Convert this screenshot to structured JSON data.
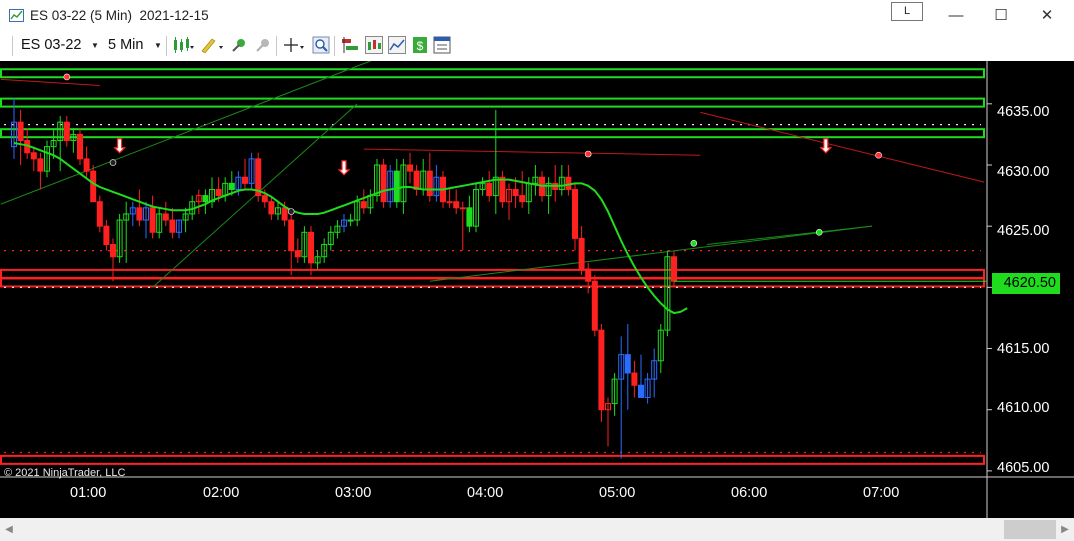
{
  "window": {
    "title": "ES 03-22 (5 Min)  2021-12-15",
    "layout_button": "L",
    "minimize": "—",
    "maximize": "☐",
    "close": "✕"
  },
  "toolbar": {
    "instrument": "ES 03-22",
    "period": "5 Min",
    "icons": [
      "bar-type-icon",
      "drawing-tool-icon",
      "attach-icon",
      "detach-icon",
      "crosshair-icon",
      "zoom-icon",
      "strategy-icon",
      "indicators-icon",
      "chart-trader-icon",
      "money-icon",
      "properties-icon"
    ]
  },
  "chart": {
    "copyright": "© 2021 NinjaTrader, LLC",
    "last_price_label": "4620.50",
    "colors": {
      "background": "#000000",
      "up_candle": "#1fdc1f",
      "down_candle": "#ff2020",
      "blue_candle": "#2a6cff",
      "ma_line": "#1fdc1f",
      "support_zone": "#ff2020",
      "resistance_zone": "#1fdc1f"
    }
  },
  "chart_data": {
    "type": "candlestick",
    "title": "ES 03-22 (5 Min)  2021-12-15",
    "instrument": "ES 03-22",
    "interval": "5 Min",
    "ylim": [
      4604.5,
      4638.5
    ],
    "y_ticks": [
      "4635.00",
      "4630.00",
      "4625.00",
      "4620.00",
      "4615.00",
      "4610.00",
      "4605.00"
    ],
    "x_ticks": [
      "01:00",
      "02:00",
      "03:00",
      "04:00",
      "05:00",
      "06:00",
      "07:00"
    ],
    "last_price": 4620.5,
    "candles": [
      {
        "o": 4631.5,
        "h": 4635.5,
        "l": 4630.5,
        "c": 4633.5,
        "col": "blue"
      },
      {
        "o": 4633.5,
        "h": 4634.5,
        "l": 4630.0,
        "c": 4632.0,
        "col": "red"
      },
      {
        "o": 4632.0,
        "h": 4633.0,
        "l": 4630.5,
        "c": 4631.0,
        "col": "red"
      },
      {
        "o": 4631.0,
        "h": 4631.5,
        "l": 4629.5,
        "c": 4630.5,
        "col": "red"
      },
      {
        "o": 4630.5,
        "h": 4631.0,
        "l": 4628.0,
        "c": 4629.5,
        "col": "red"
      },
      {
        "o": 4629.5,
        "h": 4632.0,
        "l": 4629.0,
        "c": 4631.5,
        "col": "green"
      },
      {
        "o": 4631.5,
        "h": 4633.0,
        "l": 4630.5,
        "c": 4632.0,
        "col": "green"
      },
      {
        "o": 4632.0,
        "h": 4634.0,
        "l": 4629.5,
        "c": 4633.5,
        "col": "green"
      },
      {
        "o": 4633.5,
        "h": 4634.0,
        "l": 4631.5,
        "c": 4632.0,
        "col": "red"
      },
      {
        "o": 4632.0,
        "h": 4633.0,
        "l": 4631.0,
        "c": 4632.5,
        "col": "green"
      },
      {
        "o": 4632.5,
        "h": 4633.0,
        "l": 4630.0,
        "c": 4630.5,
        "col": "red"
      },
      {
        "o": 4630.5,
        "h": 4631.5,
        "l": 4629.0,
        "c": 4629.5,
        "col": "red"
      },
      {
        "o": 4629.5,
        "h": 4630.0,
        "l": 4627.0,
        "c": 4627.0,
        "col": "red"
      },
      {
        "o": 4627.0,
        "h": 4627.5,
        "l": 4624.5,
        "c": 4625.0,
        "col": "red"
      },
      {
        "o": 4625.0,
        "h": 4625.5,
        "l": 4623.0,
        "c": 4623.5,
        "col": "red"
      },
      {
        "o": 4623.5,
        "h": 4624.0,
        "l": 4620.5,
        "c": 4622.5,
        "col": "red"
      },
      {
        "o": 4622.5,
        "h": 4626.0,
        "l": 4622.0,
        "c": 4625.5,
        "col": "green"
      },
      {
        "o": 4625.5,
        "h": 4627.0,
        "l": 4622.0,
        "c": 4626.0,
        "col": "green"
      },
      {
        "o": 4626.0,
        "h": 4627.0,
        "l": 4625.0,
        "c": 4626.5,
        "col": "blue"
      },
      {
        "o": 4626.5,
        "h": 4628.0,
        "l": 4625.0,
        "c": 4625.5,
        "col": "red"
      },
      {
        "o": 4625.5,
        "h": 4627.0,
        "l": 4624.0,
        "c": 4626.5,
        "col": "blue"
      },
      {
        "o": 4626.5,
        "h": 4627.5,
        "l": 4624.0,
        "c": 4624.5,
        "col": "red"
      },
      {
        "o": 4624.5,
        "h": 4626.5,
        "l": 4624.0,
        "c": 4626.0,
        "col": "green"
      },
      {
        "o": 4626.0,
        "h": 4627.0,
        "l": 4625.0,
        "c": 4625.5,
        "col": "red"
      },
      {
        "o": 4625.5,
        "h": 4626.5,
        "l": 4624.0,
        "c": 4624.5,
        "col": "red"
      },
      {
        "o": 4624.5,
        "h": 4625.5,
        "l": 4624.0,
        "c": 4625.5,
        "col": "blue"
      },
      {
        "o": 4625.5,
        "h": 4626.5,
        "l": 4624.5,
        "c": 4626.0,
        "col": "green"
      },
      {
        "o": 4626.0,
        "h": 4627.5,
        "l": 4625.5,
        "c": 4627.0,
        "col": "green"
      },
      {
        "o": 4627.0,
        "h": 4628.0,
        "l": 4626.0,
        "c": 4627.5,
        "col": "red"
      },
      {
        "o": 4627.5,
        "h": 4628.0,
        "l": 4626.0,
        "c": 4627.0,
        "col": "green"
      },
      {
        "o": 4627.0,
        "h": 4629.0,
        "l": 4626.5,
        "c": 4628.0,
        "col": "green"
      },
      {
        "o": 4628.0,
        "h": 4629.0,
        "l": 4627.0,
        "c": 4627.5,
        "col": "red"
      },
      {
        "o": 4627.5,
        "h": 4629.0,
        "l": 4627.0,
        "c": 4628.5,
        "col": "green"
      },
      {
        "o": 4628.5,
        "h": 4629.5,
        "l": 4627.5,
        "c": 4628.0,
        "col": "green"
      },
      {
        "o": 4628.0,
        "h": 4629.5,
        "l": 4627.5,
        "c": 4629.0,
        "col": "blue"
      },
      {
        "o": 4629.0,
        "h": 4630.5,
        "l": 4628.0,
        "c": 4628.5,
        "col": "red"
      },
      {
        "o": 4628.5,
        "h": 4631.0,
        "l": 4628.0,
        "c": 4630.5,
        "col": "blue"
      },
      {
        "o": 4630.5,
        "h": 4631.0,
        "l": 4627.0,
        "c": 4627.5,
        "col": "red"
      },
      {
        "o": 4627.5,
        "h": 4628.0,
        "l": 4626.5,
        "c": 4627.0,
        "col": "red"
      },
      {
        "o": 4627.0,
        "h": 4627.5,
        "l": 4625.5,
        "c": 4626.0,
        "col": "red"
      },
      {
        "o": 4626.0,
        "h": 4627.0,
        "l": 4625.5,
        "c": 4626.5,
        "col": "green"
      },
      {
        "o": 4626.5,
        "h": 4627.0,
        "l": 4625.0,
        "c": 4625.5,
        "col": "red"
      },
      {
        "o": 4625.5,
        "h": 4626.0,
        "l": 4621.0,
        "c": 4623.0,
        "col": "red"
      },
      {
        "o": 4623.0,
        "h": 4624.0,
        "l": 4622.0,
        "c": 4622.5,
        "col": "red"
      },
      {
        "o": 4622.5,
        "h": 4625.0,
        "l": 4622.0,
        "c": 4624.5,
        "col": "green"
      },
      {
        "o": 4624.5,
        "h": 4625.0,
        "l": 4621.0,
        "c": 4622.0,
        "col": "red"
      },
      {
        "o": 4622.0,
        "h": 4623.0,
        "l": 4621.5,
        "c": 4622.5,
        "col": "green"
      },
      {
        "o": 4622.5,
        "h": 4624.0,
        "l": 4622.0,
        "c": 4623.5,
        "col": "green"
      },
      {
        "o": 4623.5,
        "h": 4625.0,
        "l": 4623.0,
        "c": 4624.5,
        "col": "green"
      },
      {
        "o": 4624.5,
        "h": 4625.5,
        "l": 4624.0,
        "c": 4625.0,
        "col": "green"
      },
      {
        "o": 4625.0,
        "h": 4626.0,
        "l": 4624.5,
        "c": 4625.5,
        "col": "blue"
      },
      {
        "o": 4625.5,
        "h": 4626.0,
        "l": 4625.0,
        "c": 4625.5,
        "col": "green"
      },
      {
        "o": 4625.5,
        "h": 4627.5,
        "l": 4625.0,
        "c": 4627.0,
        "col": "green"
      },
      {
        "o": 4627.0,
        "h": 4628.0,
        "l": 4626.0,
        "c": 4626.5,
        "col": "red"
      },
      {
        "o": 4626.5,
        "h": 4628.0,
        "l": 4626.0,
        "c": 4627.5,
        "col": "green"
      },
      {
        "o": 4627.5,
        "h": 4630.5,
        "l": 4627.0,
        "c": 4630.0,
        "col": "green"
      },
      {
        "o": 4630.0,
        "h": 4630.5,
        "l": 4626.5,
        "c": 4627.0,
        "col": "red"
      },
      {
        "o": 4627.0,
        "h": 4630.0,
        "l": 4626.5,
        "c": 4629.5,
        "col": "blue"
      },
      {
        "o": 4629.5,
        "h": 4630.5,
        "l": 4626.5,
        "c": 4627.0,
        "col": "green"
      },
      {
        "o": 4627.0,
        "h": 4630.5,
        "l": 4626.0,
        "c": 4630.0,
        "col": "green"
      },
      {
        "o": 4630.0,
        "h": 4631.0,
        "l": 4628.5,
        "c": 4629.5,
        "col": "red"
      },
      {
        "o": 4629.5,
        "h": 4630.0,
        "l": 4627.5,
        "c": 4628.0,
        "col": "red"
      },
      {
        "o": 4628.0,
        "h": 4630.5,
        "l": 4627.5,
        "c": 4629.5,
        "col": "green"
      },
      {
        "o": 4629.5,
        "h": 4631.0,
        "l": 4627.0,
        "c": 4627.5,
        "col": "red"
      },
      {
        "o": 4627.5,
        "h": 4630.0,
        "l": 4627.0,
        "c": 4629.0,
        "col": "blue"
      },
      {
        "o": 4629.0,
        "h": 4629.5,
        "l": 4626.5,
        "c": 4627.0,
        "col": "red"
      },
      {
        "o": 4627.0,
        "h": 4628.0,
        "l": 4626.5,
        "c": 4627.0,
        "col": "red"
      },
      {
        "o": 4627.0,
        "h": 4628.0,
        "l": 4626.0,
        "c": 4626.5,
        "col": "red"
      },
      {
        "o": 4626.5,
        "h": 4627.0,
        "l": 4623.0,
        "c": 4626.5,
        "col": "red"
      },
      {
        "o": 4626.5,
        "h": 4627.5,
        "l": 4624.5,
        "c": 4625.0,
        "col": "green"
      },
      {
        "o": 4625.0,
        "h": 4628.5,
        "l": 4624.5,
        "c": 4628.0,
        "col": "green"
      },
      {
        "o": 4628.0,
        "h": 4629.0,
        "l": 4627.5,
        "c": 4628.5,
        "col": "green"
      },
      {
        "o": 4628.5,
        "h": 4629.5,
        "l": 4627.0,
        "c": 4627.5,
        "col": "red"
      },
      {
        "o": 4627.5,
        "h": 4634.5,
        "l": 4626.0,
        "c": 4629.0,
        "col": "green"
      },
      {
        "o": 4629.0,
        "h": 4629.5,
        "l": 4626.5,
        "c": 4627.0,
        "col": "red"
      },
      {
        "o": 4627.0,
        "h": 4628.5,
        "l": 4625.5,
        "c": 4628.0,
        "col": "red"
      },
      {
        "o": 4628.0,
        "h": 4629.0,
        "l": 4626.5,
        "c": 4627.5,
        "col": "red"
      },
      {
        "o": 4627.5,
        "h": 4629.5,
        "l": 4626.5,
        "c": 4627.0,
        "col": "red"
      },
      {
        "o": 4627.0,
        "h": 4629.0,
        "l": 4626.0,
        "c": 4628.5,
        "col": "green"
      },
      {
        "o": 4628.5,
        "h": 4630.0,
        "l": 4627.5,
        "c": 4629.0,
        "col": "green"
      },
      {
        "o": 4629.0,
        "h": 4629.5,
        "l": 4627.0,
        "c": 4627.5,
        "col": "red"
      },
      {
        "o": 4627.5,
        "h": 4629.0,
        "l": 4626.0,
        "c": 4628.5,
        "col": "green"
      },
      {
        "o": 4628.5,
        "h": 4630.0,
        "l": 4627.0,
        "c": 4628.0,
        "col": "red"
      },
      {
        "o": 4628.0,
        "h": 4630.0,
        "l": 4627.5,
        "c": 4629.0,
        "col": "green"
      },
      {
        "o": 4629.0,
        "h": 4630.0,
        "l": 4627.5,
        "c": 4628.0,
        "col": "red"
      },
      {
        "o": 4628.0,
        "h": 4628.5,
        "l": 4623.0,
        "c": 4624.0,
        "col": "red"
      },
      {
        "o": 4624.0,
        "h": 4625.0,
        "l": 4621.0,
        "c": 4621.5,
        "col": "red"
      },
      {
        "o": 4621.5,
        "h": 4622.0,
        "l": 4619.5,
        "c": 4620.5,
        "col": "red"
      },
      {
        "o": 4620.5,
        "h": 4621.0,
        "l": 4616.0,
        "c": 4616.5,
        "col": "red"
      },
      {
        "o": 4616.5,
        "h": 4617.0,
        "l": 4609.0,
        "c": 4610.0,
        "col": "red"
      },
      {
        "o": 4610.0,
        "h": 4611.0,
        "l": 4607.0,
        "c": 4610.5,
        "col": "red"
      },
      {
        "o": 4610.5,
        "h": 4613.0,
        "l": 4609.5,
        "c": 4612.5,
        "col": "green"
      },
      {
        "o": 4612.5,
        "h": 4616.0,
        "l": 4606.0,
        "c": 4614.5,
        "col": "blue"
      },
      {
        "o": 4614.5,
        "h": 4617.0,
        "l": 4610.0,
        "c": 4613.0,
        "col": "blue"
      },
      {
        "o": 4613.0,
        "h": 4614.0,
        "l": 4611.0,
        "c": 4612.0,
        "col": "red"
      },
      {
        "o": 4612.0,
        "h": 4614.5,
        "l": 4611.0,
        "c": 4611.0,
        "col": "blue"
      },
      {
        "o": 4611.0,
        "h": 4613.0,
        "l": 4610.5,
        "c": 4612.5,
        "col": "blue"
      },
      {
        "o": 4612.5,
        "h": 4615.0,
        "l": 4611.0,
        "c": 4614.0,
        "col": "blue"
      },
      {
        "o": 4614.0,
        "h": 4617.0,
        "l": 4613.0,
        "c": 4616.5,
        "col": "green"
      },
      {
        "o": 4616.5,
        "h": 4623.0,
        "l": 4616.0,
        "c": 4622.5,
        "col": "green"
      },
      {
        "o": 4622.5,
        "h": 4623.0,
        "l": 4620.0,
        "c": 4620.5,
        "col": "red"
      }
    ],
    "moving_average": [
      4631.8,
      4631.7,
      4631.6,
      4631.4,
      4631.2,
      4631.0,
      4630.8,
      4630.5,
      4630.1,
      4629.7,
      4629.3,
      4628.9,
      4628.5,
      4628.2,
      4628.0,
      4627.8,
      4627.6,
      4627.4,
      4627.2,
      4627.0,
      4626.8,
      4626.6,
      4626.5,
      4626.4,
      4626.3,
      4626.3,
      4626.3,
      4626.4,
      4626.6,
      4626.8,
      4627.1,
      4627.3,
      4627.5,
      4627.7,
      4627.9,
      4628.0,
      4628.0,
      4627.9,
      4627.7,
      4627.4,
      4627.0,
      4626.6,
      4626.3,
      4626.1,
      4626.0,
      4626.0,
      4626.0,
      4626.1,
      4626.3,
      4626.5,
      4626.7,
      4626.9,
      4627.1,
      4627.3,
      4627.5,
      4627.7,
      4627.9,
      4628.0,
      4628.1,
      4628.2,
      4628.2,
      4628.1,
      4628.0,
      4628.0,
      4628.0,
      4628.0,
      4628.1,
      4628.2,
      4628.3,
      4628.4,
      4628.5,
      4628.6,
      4628.7,
      4628.8,
      4628.8,
      4628.8,
      4628.7,
      4628.6,
      4628.5,
      4628.4,
      4628.3,
      4628.3,
      4628.3,
      4628.3,
      4628.4,
      4628.5,
      4628.5,
      4628.3,
      4627.9,
      4627.2,
      4626.2,
      4625.0,
      4623.8,
      4622.7,
      4621.7,
      4620.8,
      4620.0,
      4619.3,
      4618.7,
      4618.2,
      4617.9,
      4618.0,
      4618.3
    ],
    "horizontal_levels": [
      {
        "price": 4637.5,
        "color": "green"
      },
      {
        "price": 4635.1,
        "color": "green"
      },
      {
        "price": 4632.6,
        "color": "green"
      },
      {
        "price": 4621.1,
        "color": "red"
      },
      {
        "price": 4620.4,
        "color": "red"
      },
      {
        "price": 4605.9,
        "color": "red"
      }
    ]
  }
}
